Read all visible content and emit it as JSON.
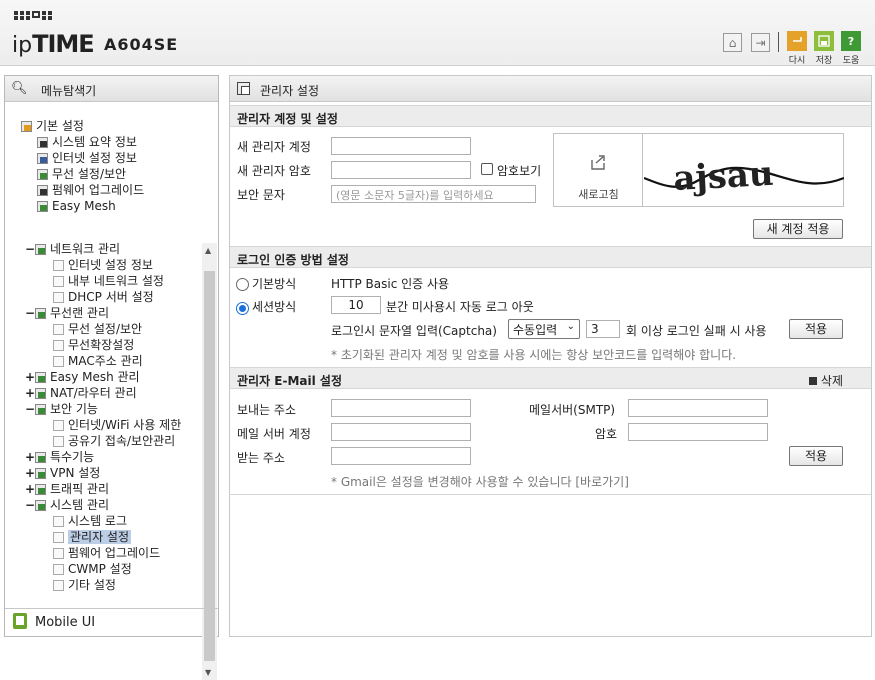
{
  "header": {
    "brand_small": "ip",
    "brand_big": "TIME",
    "model": "A604SE",
    "buttons": [
      {
        "label": "다시",
        "icon": "return-icon",
        "color": "#e5a22a"
      },
      {
        "label": "저장",
        "icon": "save-icon",
        "color": "#8dbf3c"
      },
      {
        "label": "도움",
        "icon": "help-icon",
        "color": "#3f9a35",
        "glyph": "?"
      }
    ]
  },
  "nav": {
    "title": "메뉴탐색기",
    "mobile_label": "Mobile UI",
    "top_items": [
      {
        "label": "기본 설정",
        "expand": ""
      },
      {
        "label": "시스템 요약 정보"
      },
      {
        "label": "인터넷 설정 정보"
      },
      {
        "label": "무선 설정/보안"
      },
      {
        "label": "펌웨어 업그레이드"
      },
      {
        "label": "Easy Mesh"
      }
    ],
    "tree": [
      {
        "label": "네트워크 관리",
        "expand": "−",
        "level": 0
      },
      {
        "label": "인터넷 설정 정보",
        "level": 1
      },
      {
        "label": "내부 네트워크 설정",
        "level": 1
      },
      {
        "label": "DHCP 서버 설정",
        "level": 1
      },
      {
        "label": "무선랜 관리",
        "expand": "−",
        "level": 0
      },
      {
        "label": "무선 설정/보안",
        "level": 1
      },
      {
        "label": "무선확장설정",
        "level": 1
      },
      {
        "label": "MAC주소 관리",
        "level": 1
      },
      {
        "label": "Easy Mesh 관리",
        "expand": "+",
        "level": 0
      },
      {
        "label": "NAT/라우터 관리",
        "expand": "+",
        "level": 0
      },
      {
        "label": "보안 기능",
        "expand": "−",
        "level": 0
      },
      {
        "label": "인터넷/WiFi 사용 제한",
        "level": 1
      },
      {
        "label": "공유기 접속/보안관리",
        "level": 1
      },
      {
        "label": "특수기능",
        "expand": "+",
        "level": 0
      },
      {
        "label": "VPN 설정",
        "expand": "+",
        "level": 0
      },
      {
        "label": "트래픽 관리",
        "expand": "+",
        "level": 0
      },
      {
        "label": "시스템 관리",
        "expand": "−",
        "level": 0
      },
      {
        "label": "시스템 로그",
        "level": 1
      },
      {
        "label": "관리자 설정",
        "level": 1,
        "selected": true
      },
      {
        "label": "펌웨어 업그레이드",
        "level": 1
      },
      {
        "label": "CWMP 설정",
        "level": 1
      },
      {
        "label": "기타 설정",
        "level": 1
      }
    ]
  },
  "main": {
    "title": "관리자 설정",
    "account": {
      "section_title": "관리자 계정 및 설정",
      "new_id_label": "새 관리자 계정",
      "new_pw_label": "새 관리자 암호",
      "show_pw_label": "암호보기",
      "captcha_label": "보안 문자",
      "captcha_placeholder": "(영문 소문자 5글자)를 입력하세요",
      "captcha_refresh": "새로고침",
      "captcha_text": "ajsau",
      "apply_button": "새 계정 적용"
    },
    "login": {
      "section_title": "로그인 인증 방법 설정",
      "basic_label": "기본방식",
      "basic_desc": "HTTP Basic 인증 사용",
      "session_label": "세션방식",
      "session_minutes": "10",
      "session_desc": "분간 미사용시 자동 로그 아웃",
      "captcha_mode_label": "로그인시 문자열 입력(Captcha)",
      "captcha_mode_value": "수동입력",
      "fail_count": "3",
      "fail_desc": "회 이상 로그인 실패 시 사용",
      "apply_button": "적용",
      "note": "* 초기화된 관리자 계정 및 암호를 사용 시에는 항상 보안코드를 입력해야 합니다."
    },
    "email": {
      "section_title": "관리자 E-Mail 설정",
      "delete_label": "삭제",
      "from_label": "보내는 주소",
      "smtp_label": "메일서버(SMTP)",
      "account_label": "메일 서버 계정",
      "password_label": "암호",
      "to_label": "받는 주소",
      "apply_button": "적용",
      "note": "* Gmail은 설정을 변경해야 사용할 수 있습니다 [바로가기]"
    }
  }
}
